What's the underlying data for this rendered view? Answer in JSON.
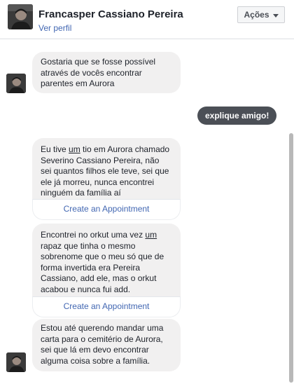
{
  "header": {
    "name": "Francasper Cassiano Pereira",
    "profile_link": "Ver perfil",
    "actions_label": "Ações"
  },
  "messages": {
    "m1": "Gostaria que se fosse possível através de vocês encontrar parentes em Aurora",
    "m2": "explique amigo!",
    "m3_a": "Eu tive ",
    "m3_u": "um",
    "m3_b": " tio em Aurora chamado Severino Cassiano Pereira, não sei quantos filhos ele teve, sei que ele já morreu, nunca encontrei ninguém da família aí",
    "m3_action": "Create an Appointment",
    "m4_a": "Encontrei no orkut uma vez ",
    "m4_u": "um",
    "m4_b": " rapaz que tinha o mesmo sobrenome que o meu só que de forma invertida era Pereira Cassiano, add ele, mas o orkut acabou e nunca fui add.",
    "m4_action": "Create an Appointment",
    "m5": "Estou até querendo mandar uma carta para o cemitério de Aurora, sei que lá em devo encontrar alguma coisa sobre a família."
  },
  "colors": {
    "incoming_bubble": "#f1f0f0",
    "outgoing_bubble": "#4b4f56",
    "link_blue": "#4267b2"
  }
}
